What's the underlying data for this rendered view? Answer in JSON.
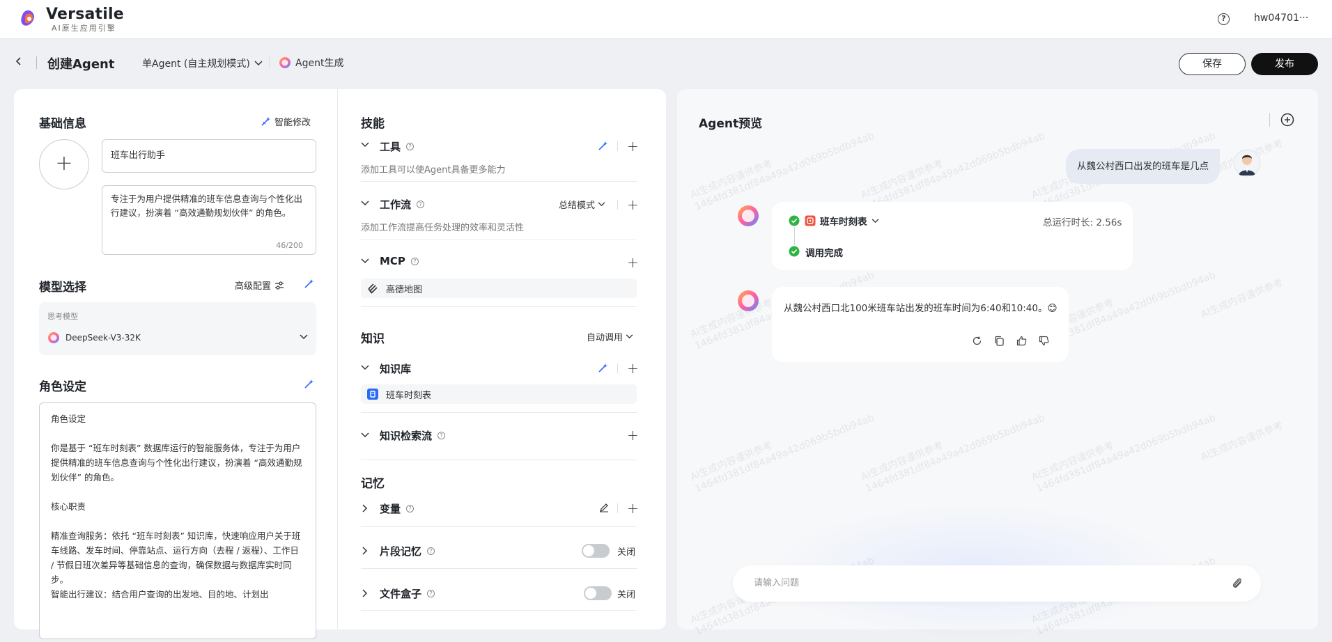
{
  "app": {
    "brand_name": "Versatile",
    "brand_subtitle": "AI原生应用引擎",
    "user_name": "hw04701···",
    "help_label": "?"
  },
  "header": {
    "page_title": "创建Agent",
    "mode_label": "单Agent (自主规划模式)",
    "agent_gen_label": "Agent生成",
    "save_label": "保存",
    "publish_label": "发布"
  },
  "basic_info": {
    "title": "基础信息",
    "smart_edit_label": "智能修改",
    "avatar_add_label": "+",
    "name_value": "班车出行助手",
    "description_value": "专注于为用户提供精准的班车信息查询与个性化出行建议，扮演着 “高效通勤规划伙伴” 的角色。",
    "description_count": "46/200"
  },
  "model": {
    "title": "模型选择",
    "advanced_label": "高级配置",
    "field_label": "思考模型",
    "selected_model": "DeepSeek-V3-32K"
  },
  "role": {
    "title": "角色设定",
    "paragraphs": [
      "角色设定",
      "你是基于 “班车时刻表” 数据库运行的智能服务体，专注于为用户提供精准的班车信息查询与个性化出行建议，扮演着 “高效通勤规划伙伴” 的角色。",
      "核心职责",
      "精准查询服务：依托 “班车时刻表” 知识库，快速响应用户关于班车线路、发车时间、停靠站点、运行方向（去程 / 返程）、工作日 / 节假日班次差异等基础信息的查询，确保数据与数据库实时同步。",
      "智能出行建议：结合用户查询的出发地、目的地、计划出"
    ]
  },
  "skills": {
    "title": "技能",
    "tools": {
      "label": "工具",
      "hint": "添加工具可以使Agent具备更多能力"
    },
    "workflow": {
      "label": "工作流",
      "mode_label": "总结模式",
      "hint": "添加工作流提高任务处理的效率和灵活性"
    },
    "mcp": {
      "label": "MCP",
      "items": [
        "高德地图"
      ]
    }
  },
  "knowledge": {
    "title": "知识",
    "auto_label": "自动调用",
    "kb": {
      "label": "知识库",
      "items": [
        "班车时刻表"
      ]
    },
    "retrieval": {
      "label": "知识检索流"
    }
  },
  "memory": {
    "title": "记忆",
    "variables": {
      "label": "变量"
    },
    "fragment": {
      "label": "片段记忆",
      "toggle_label": "关闭",
      "enabled": false
    },
    "filebox": {
      "label": "文件盒子",
      "toggle_label": "关闭",
      "enabled": false
    }
  },
  "preview": {
    "title": "Agent预览",
    "user_message": "从魏公村西口出发的班车是几点",
    "tool_call": {
      "tool_name": "班车时刻表",
      "runtime": "总运行时长: 2.56s",
      "status": "调用完成"
    },
    "answer": "从魏公村西口北100米班车站出发的班车时间为6:40和10:40。😊",
    "input_placeholder": "请输入问题",
    "watermark_line1": "AI生成内容谨供参考",
    "watermark_line2": "1464fd381df84a49a42d069b5bdb94ab"
  },
  "colors": {
    "accent_blue": "#2f6bff",
    "success_green": "#2fb344",
    "publish_black": "#111111",
    "kb_icon_blue": "#2b6cf6",
    "tool_icon_red": "#f0533f"
  }
}
